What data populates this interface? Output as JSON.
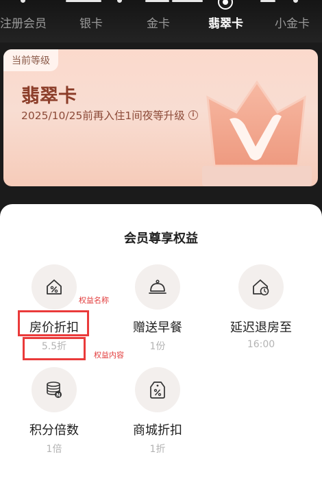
{
  "tiers": [
    {
      "label": "注册会员",
      "active": false
    },
    {
      "label": "银卡",
      "active": false
    },
    {
      "label": "金卡",
      "active": false
    },
    {
      "label": "翡翠卡",
      "active": true
    },
    {
      "label": "小金卡",
      "active": false
    }
  ],
  "current_level": {
    "tag": "当前等级",
    "name": "翡翠卡",
    "description": "2025/10/25前再入住1间夜等升级",
    "info_icon": "info-icon",
    "badge_icon": "crown-v-icon"
  },
  "benefits_section": {
    "title": "会员尊享权益",
    "items": [
      {
        "icon": "house-percent-icon",
        "name": "房价折扣",
        "value": "5.5折"
      },
      {
        "icon": "cloche-icon",
        "name": "赠送早餐",
        "value": "1份"
      },
      {
        "icon": "house-clock-icon",
        "name": "延迟退房至",
        "value": "16:00"
      },
      {
        "icon": "coin-stack-icon",
        "name": "积分倍数",
        "value": "1倍"
      },
      {
        "icon": "tag-percent-icon",
        "name": "商城折扣",
        "value": "1折"
      }
    ]
  },
  "annotations": {
    "name_label": "权益名称",
    "content_label": "权益内容"
  },
  "colors": {
    "annotation_red": "#ea3a3a",
    "level_text": "#8c3e2a",
    "card_gradient_top": "#fbd9cc"
  }
}
